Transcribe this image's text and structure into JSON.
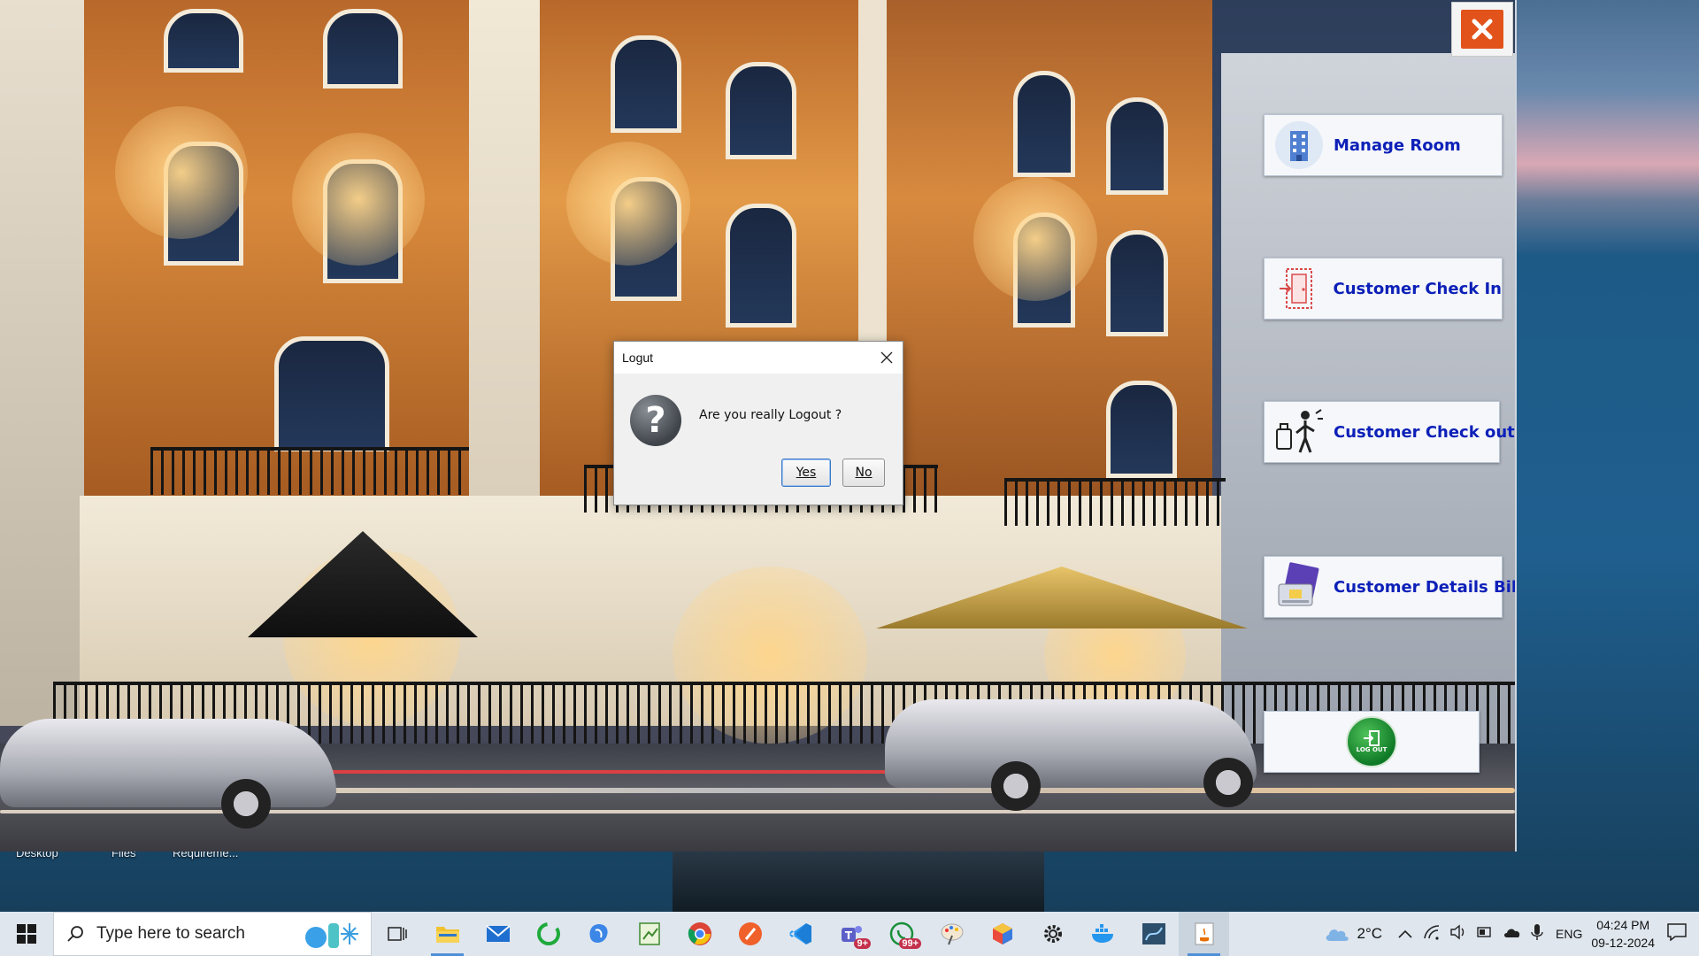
{
  "desktop": {
    "labels": [
      "Desktop",
      "Files",
      "Requireme..."
    ]
  },
  "app": {
    "close_icon": "close-icon",
    "menu": [
      {
        "label": "Manage Room",
        "icon": "building-icon"
      },
      {
        "label": "Customer Check In",
        "icon": "door-icon"
      },
      {
        "label": "Customer Check out",
        "icon": "luggage-icon"
      },
      {
        "label": "Customer Details Bill",
        "icon": "bill-icon"
      },
      {
        "label": "",
        "icon": "logout-icon",
        "icon_text": "LOG OUT"
      }
    ]
  },
  "dialog": {
    "title": "Logut",
    "message": "Are you really Logout ?",
    "yes_label": "Yes",
    "no_label": "No"
  },
  "taskbar": {
    "search_placeholder": "Type here to search",
    "apps": [
      {
        "icon": "task-view-icon"
      },
      {
        "icon": "file-explorer-icon"
      },
      {
        "icon": "mail-icon"
      },
      {
        "icon": "refresh-app-icon"
      },
      {
        "icon": "blue-app-icon"
      },
      {
        "icon": "notepad-app-icon"
      },
      {
        "icon": "chrome-icon"
      },
      {
        "icon": "pen-app-icon"
      },
      {
        "icon": "vscode-icon"
      },
      {
        "icon": "teams-icon",
        "badge": "9+"
      },
      {
        "icon": "whatsapp-icon",
        "badge": "99+"
      },
      {
        "icon": "paint-icon"
      },
      {
        "icon": "cube-app-icon"
      },
      {
        "icon": "settings-icon"
      },
      {
        "icon": "docker-icon"
      },
      {
        "icon": "sql-app-icon"
      },
      {
        "icon": "java-icon"
      }
    ],
    "weather": "2°C",
    "language": "ENG",
    "time": "04:24 PM",
    "date": "09-12-2024"
  },
  "colors": {
    "menu_text": "#0d20b8",
    "close_bg": "#e2531b",
    "taskbar_bg": "#dfe6ee"
  }
}
